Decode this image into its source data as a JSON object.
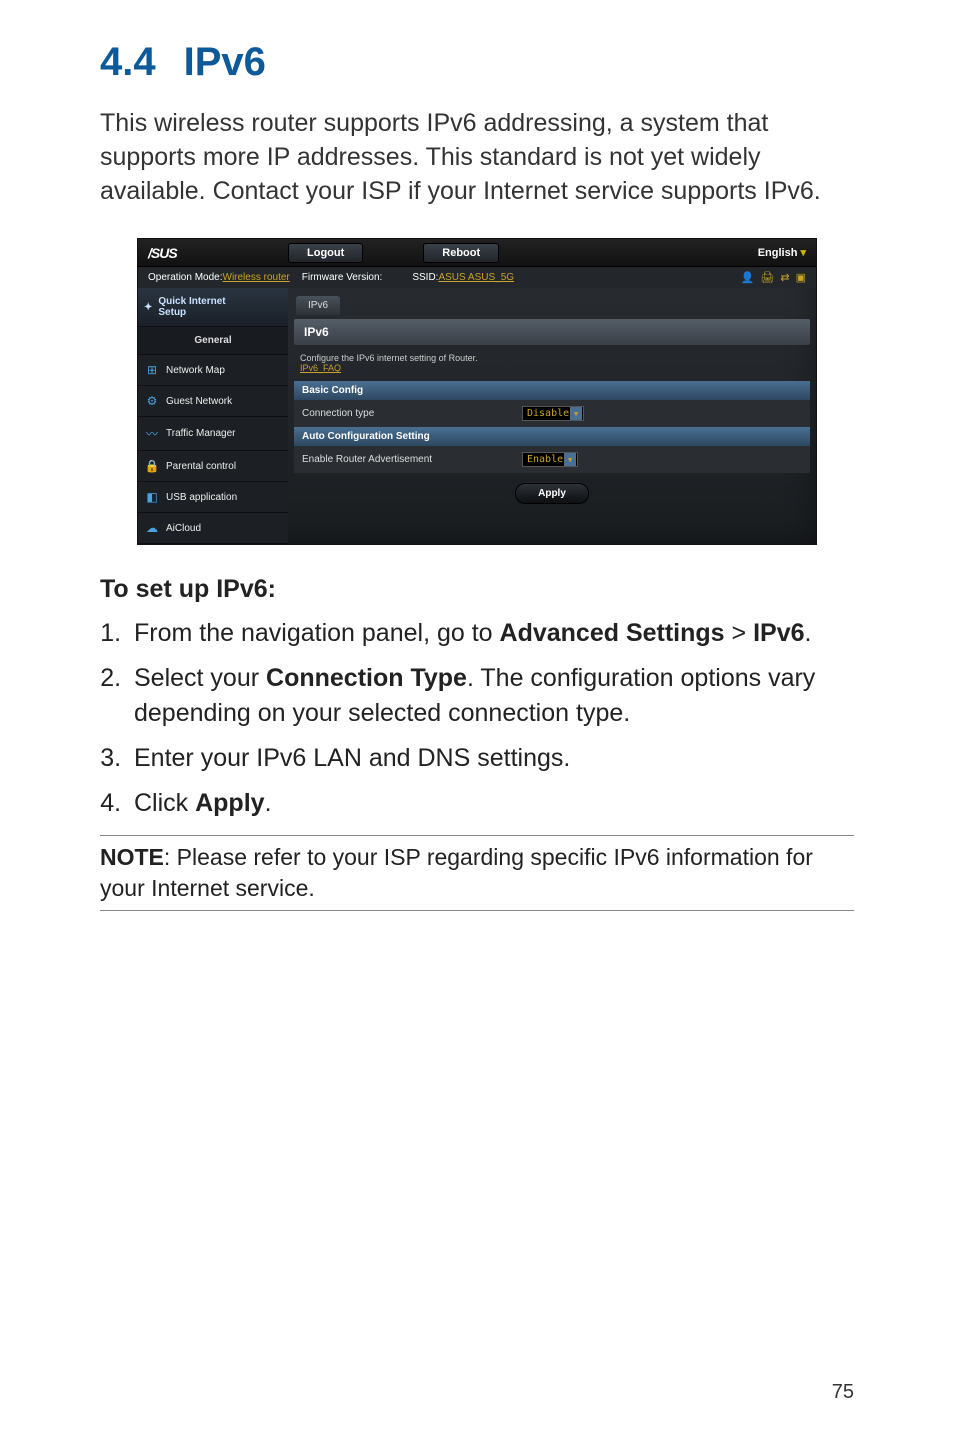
{
  "heading": {
    "num": "4.4",
    "title": "IPv6"
  },
  "intro": "This wireless router supports IPv6 addressing, a system that supports more IP addresses. This standard is not yet widely available. Contact your ISP if your Internet service supports IPv6.",
  "screenshot": {
    "logo": "/SUS",
    "logout": "Logout",
    "reboot": "Reboot",
    "language": "English",
    "opmode_label": "Operation Mode: ",
    "opmode_value": "Wireless router",
    "fwver_label": "Firmware Version:",
    "ssid_label": "SSID: ",
    "ssid_value": "ASUS  ASUS_5G",
    "qis": {
      "line1": "Quick Internet",
      "line2": "Setup"
    },
    "general": "General",
    "sidebar": [
      {
        "icon": "⊞",
        "label": "Network Map"
      },
      {
        "icon": "⚙",
        "label": "Guest Network"
      },
      {
        "icon": "〰",
        "label": "Traffic Manager"
      },
      {
        "icon": "🔒",
        "label": "Parental control"
      },
      {
        "icon": "◧",
        "label": "USB application"
      },
      {
        "icon": "☁",
        "label": "AiCloud"
      }
    ],
    "tab": "IPv6",
    "panel_title": "IPv6",
    "panel_sub": "Configure the IPv6 internet setting of Router.",
    "faq": "IPv6_FAQ",
    "basic_title": "Basic Config",
    "conn_label": "Connection type",
    "conn_value": "Disable",
    "auto_title": "Auto Configuration Setting",
    "adv_label": "Enable Router Advertisement",
    "adv_value": "Enable",
    "apply": "Apply"
  },
  "steps_heading": "To set up IPv6:",
  "steps": {
    "s1a": "From the navigation panel, go to ",
    "s1b": "Advanced Settings",
    "s1c": " > ",
    "s1d": "IPv6",
    "s1e": ".",
    "s2a": "Select your ",
    "s2b": "Connection Type",
    "s2c": ". The configuration options vary depending on your selected connection type.",
    "s3": "Enter your IPv6 LAN and DNS settings.",
    "s4a": "Click ",
    "s4b": "Apply",
    "s4c": "."
  },
  "note": {
    "label": "NOTE",
    "text": ": Please refer to your ISP regarding specific IPv6 information for your Internet service."
  },
  "page": "75"
}
